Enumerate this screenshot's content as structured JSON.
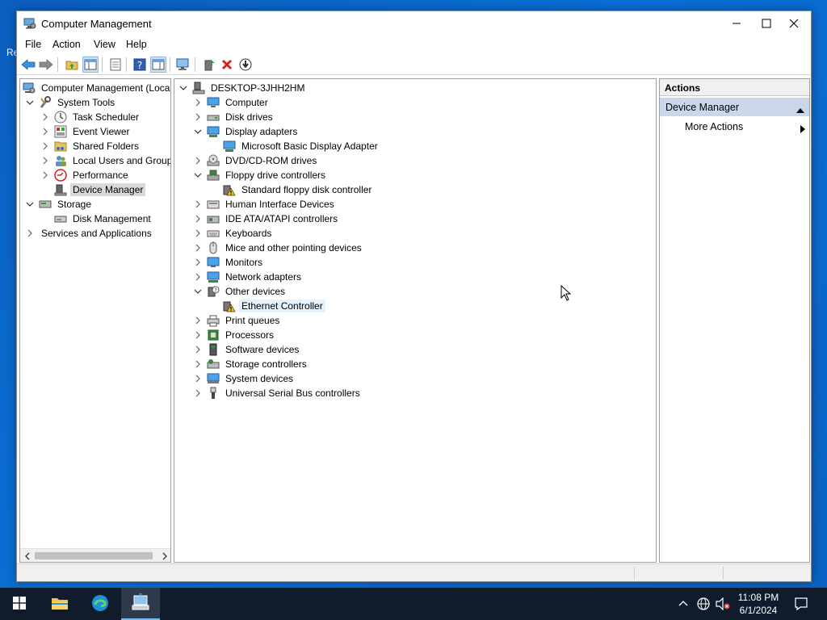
{
  "desktop": {
    "partial_icon_label": "Re"
  },
  "window": {
    "title": "Computer Management"
  },
  "menu": [
    "File",
    "Action",
    "View",
    "Help"
  ],
  "toolbar_icons": [
    "back-arrow-icon",
    "forward-arrow-icon",
    "up-folder-icon",
    "show-hide-console-tree-icon",
    "properties-icon",
    "help-icon",
    "show-action-pane-icon",
    "update-driver-icon",
    "enable-device-icon",
    "uninstall-device-icon",
    "disable-device-icon"
  ],
  "left_tree": {
    "root": "Computer Management (Local",
    "system_tools": "System Tools",
    "task_scheduler": "Task Scheduler",
    "event_viewer": "Event Viewer",
    "shared_folders": "Shared Folders",
    "local_users": "Local Users and Groups",
    "performance": "Performance",
    "device_manager": "Device Manager",
    "storage": "Storage",
    "disk_management": "Disk Management",
    "services_apps": "Services and Applications"
  },
  "device_tree": {
    "root": "DESKTOP-3JHH2HM",
    "categories": {
      "computer": "Computer",
      "disk_drives": "Disk drives",
      "display_adapters": "Display adapters",
      "display_adapter_child": "Microsoft Basic Display Adapter",
      "dvd": "DVD/CD-ROM drives",
      "floppy_controllers": "Floppy drive controllers",
      "floppy_child": "Standard floppy disk controller",
      "hid": "Human Interface Devices",
      "ide": "IDE ATA/ATAPI controllers",
      "keyboards": "Keyboards",
      "mice": "Mice and other pointing devices",
      "monitors": "Monitors",
      "network": "Network adapters",
      "other": "Other devices",
      "other_child": "Ethernet Controller",
      "print": "Print queues",
      "processors": "Processors",
      "software": "Software devices",
      "storage_ctrl": "Storage controllers",
      "system": "System devices",
      "usb": "Universal Serial Bus controllers"
    }
  },
  "actions": {
    "header": "Actions",
    "section": "Device Manager",
    "more": "More Actions"
  },
  "taskbar": {
    "time": "11:08 PM",
    "date": "6/1/2024"
  },
  "colors": {
    "accent": "#0078d7",
    "selection": "#d9d9d9",
    "actions_section": "#c9d7e9",
    "taskbar": "#101c2c"
  }
}
